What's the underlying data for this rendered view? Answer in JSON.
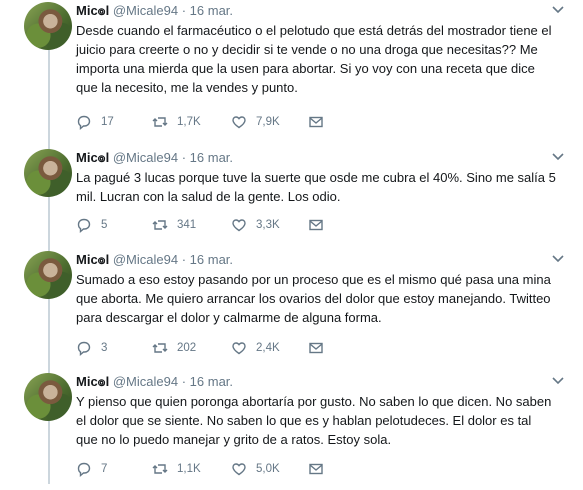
{
  "tweets": [
    {
      "name": "Mic๏l",
      "handle": "@Micale94",
      "separator": "·",
      "date": "16 mar.",
      "text": "Desde cuando el farmacéutico o el pelotudo que está detrás del mostrador tiene el juicio para creerte o no y decidir si te vende o no una droga que necesitas?? Me importa una mierda que la usen para abortar. Si yo voy con una receta que dice que la necesito, me la vendes y punto.",
      "replies": "17",
      "retweets": "1,7K",
      "likes": "7,9K"
    },
    {
      "name": "Mic๏l",
      "handle": "@Micale94",
      "separator": "·",
      "date": "16 mar.",
      "text": "La pagué 3 lucas porque tuve la suerte que osde me cubra el 40%. Sino me salía 5 mil. Lucran con la salud de la gente. Los odio.",
      "replies": "5",
      "retweets": "341",
      "likes": "3,3K"
    },
    {
      "name": "Mic๏l",
      "handle": "@Micale94",
      "separator": "·",
      "date": "16 mar.",
      "text": "Sumado a eso estoy pasando por un proceso que es el mismo qué pasa una mina que aborta. Me quiero arrancar los ovarios del dolor que estoy manejando. Twitteo para descargar el dolor y calmarme de alguna forma.",
      "replies": "3",
      "retweets": "202",
      "likes": "2,4K"
    },
    {
      "name": "Mic๏l",
      "handle": "@Micale94",
      "separator": "·",
      "date": "16 mar.",
      "text": "Y pienso que quien poronga abortaría por gusto. No saben lo que dicen. No saben el dolor que se siente. No saben lo que es y hablan pelotudeces. El dolor es tal que no lo puedo manejar y grito de a ratos. Estoy sola.",
      "replies": "7",
      "retweets": "1,1K",
      "likes": "5,0K"
    }
  ],
  "icons": {
    "reply": "reply-icon",
    "retweet": "retweet-icon",
    "like": "heart-icon",
    "dm": "envelope-icon",
    "more": "chevron-down-icon"
  },
  "colors": {
    "text": "#14171a",
    "muted": "#657786",
    "thread_line": "#ccd6dd"
  }
}
